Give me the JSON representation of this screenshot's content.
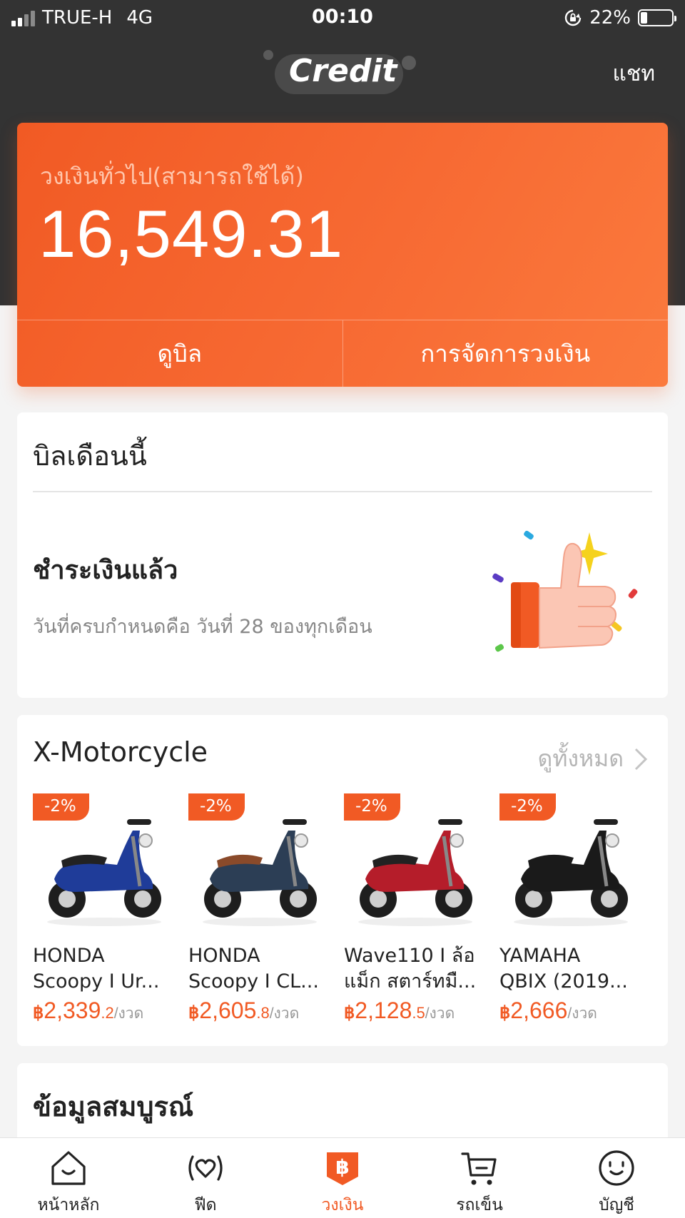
{
  "status_bar": {
    "carrier": "TRUE-H",
    "network": "4G",
    "time": "00:10",
    "battery": "22%",
    "battery_level": 0.22
  },
  "header": {
    "logo": "Credit",
    "chat": "แชท"
  },
  "credit": {
    "label": "วงเงินทั่วไป(สามารถใช้ได้)",
    "amount": "16,549.31",
    "view_bill": "ดูบิล",
    "manage_limit": "การจัดการวงเงิน"
  },
  "bill": {
    "title": "บิลเดือนนี้",
    "status": "ชำระเงินแล้ว",
    "due": "วันที่ครบกำหนดคือ วันที่ 28 ของทุกเดือน"
  },
  "moto": {
    "title": "X-Motorcycle",
    "see_all": "ดูทั้งหมด",
    "products": [
      {
        "badge": "-2%",
        "line1": "HONDA",
        "line2": "Scoopy I Ur...",
        "currency": "฿",
        "price_int": "2,339",
        "price_dec": ".2",
        "unit": "/งวด",
        "color": "#1f3c99",
        "seat": "#222222"
      },
      {
        "badge": "-2%",
        "line1": "HONDA",
        "line2": "Scoopy I CL...",
        "currency": "฿",
        "price_int": "2,605",
        "price_dec": ".8",
        "unit": "/งวด",
        "color": "#2c3e55",
        "seat": "#8a4a2a"
      },
      {
        "badge": "-2%",
        "line1": "Wave110 I ล้อ",
        "line2": "แม็ก สตาร์ทมื...",
        "currency": "฿",
        "price_int": "2,128",
        "price_dec": ".5",
        "unit": "/งวด",
        "color": "#b51d2a",
        "seat": "#222222"
      },
      {
        "badge": "-2%",
        "line1": "YAMAHA",
        "line2": "QBIX (2019...",
        "currency": "฿",
        "price_int": "2,666",
        "price_dec": "",
        "unit": "/งวด",
        "color": "#1a1a1a",
        "seat": "#1a1a1a"
      }
    ]
  },
  "info": {
    "title": "ข้อมูลสมบูรณ์"
  },
  "nav": [
    {
      "label": "หน้าหลัก",
      "icon": "home-icon"
    },
    {
      "label": "ฟีด",
      "icon": "feed-icon"
    },
    {
      "label": "วงเงิน",
      "icon": "credit-icon",
      "active": true
    },
    {
      "label": "รถเข็น",
      "icon": "cart-icon"
    },
    {
      "label": "บัญชี",
      "icon": "account-icon"
    }
  ],
  "colors": {
    "accent": "#f15a24",
    "header": "#333333",
    "background": "#f4f4f4"
  }
}
